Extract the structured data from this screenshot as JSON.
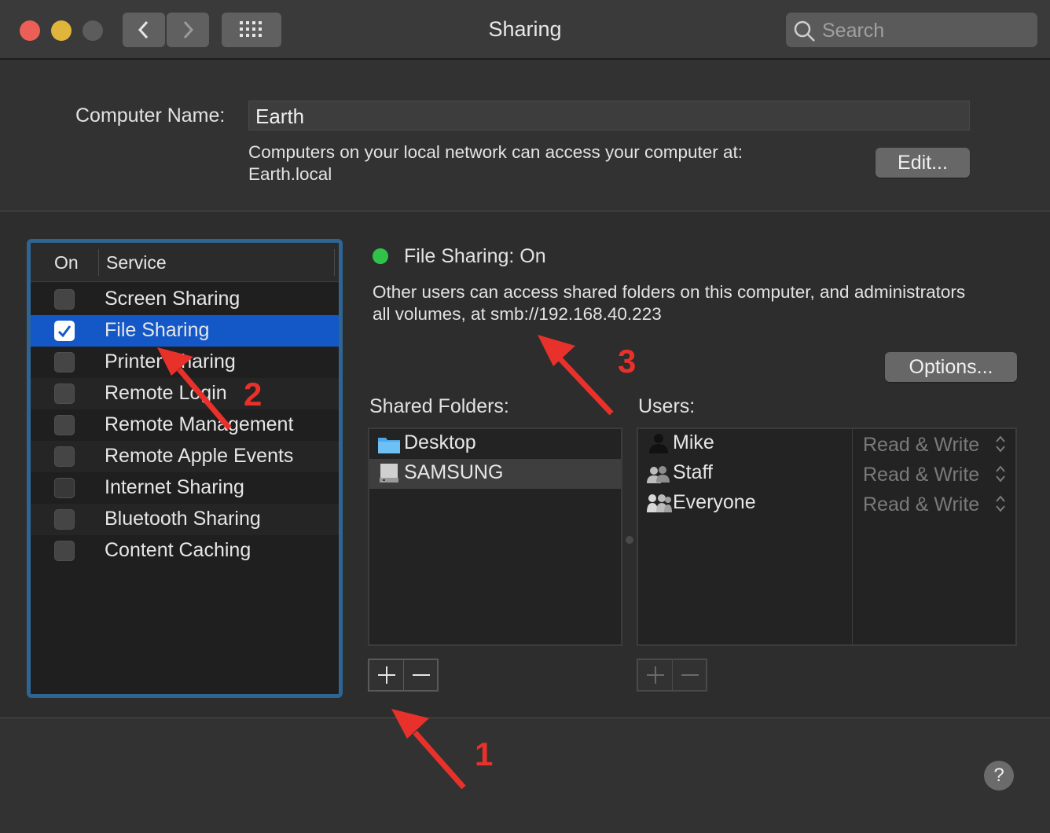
{
  "window": {
    "title": "Sharing",
    "search_placeholder": "Search"
  },
  "computer_name": {
    "label": "Computer Name:",
    "value": "Earth",
    "local_access_line1": "Computers on your local network can access your computer at:",
    "local_access_line2": "Earth.local",
    "edit_button": "Edit..."
  },
  "services": {
    "header_on": "On",
    "header_service": "Service",
    "items": [
      {
        "label": "Screen Sharing",
        "checked": false
      },
      {
        "label": "File Sharing",
        "checked": true
      },
      {
        "label": "Printer Sharing",
        "checked": false
      },
      {
        "label": "Remote Login",
        "checked": false
      },
      {
        "label": "Remote Management",
        "checked": false
      },
      {
        "label": "Remote Apple Events",
        "checked": false
      },
      {
        "label": "Internet Sharing",
        "checked": false
      },
      {
        "label": "Bluetooth Sharing",
        "checked": false
      },
      {
        "label": "Content Caching",
        "checked": false
      }
    ]
  },
  "detail": {
    "status": "File Sharing: On",
    "status_color": "#31c24a",
    "description_line1": "Other users can access shared folders on this computer, and administrators",
    "description_line2": "all volumes, at smb://192.168.40.223",
    "options_button": "Options...",
    "shared_folders_label": "Shared Folders:",
    "users_label": "Users:",
    "folders": [
      {
        "name": "Desktop",
        "icon": "folder-icon"
      },
      {
        "name": "SAMSUNG",
        "icon": "drive-icon"
      }
    ],
    "users": [
      {
        "name": "Mike",
        "icon": "user-icon",
        "permission": "Read & Write"
      },
      {
        "name": "Staff",
        "icon": "group-icon",
        "permission": "Read & Write"
      },
      {
        "name": "Everyone",
        "icon": "everyone-icon",
        "permission": "Read & Write"
      }
    ]
  },
  "help_button": "?",
  "annotations": {
    "one": "1",
    "two": "2",
    "three": "3",
    "color": "#e8312a"
  }
}
